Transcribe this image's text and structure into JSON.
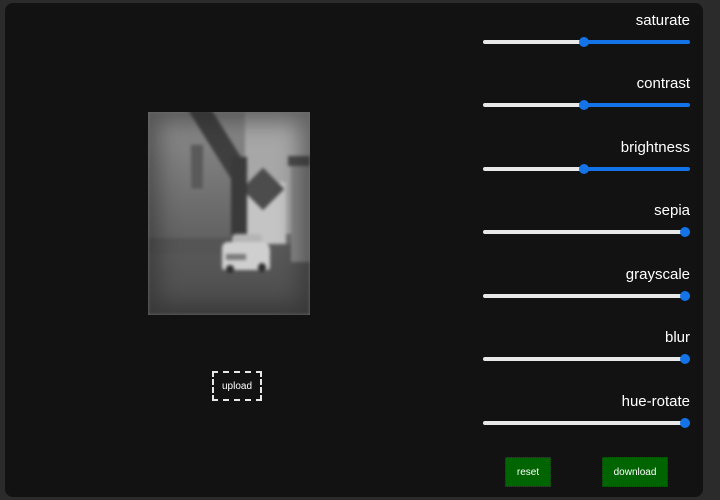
{
  "preview": {
    "description": "blurred grayscale photo of a village street with a white car"
  },
  "upload": {
    "label": "upload"
  },
  "filters": [
    {
      "label": "saturate",
      "value_percent": 50
    },
    {
      "label": "contrast",
      "value_percent": 50
    },
    {
      "label": "brightness",
      "value_percent": 50
    },
    {
      "label": "sepia",
      "value_percent": 100
    },
    {
      "label": "grayscale",
      "value_percent": 100
    },
    {
      "label": "blur",
      "value_percent": 100
    },
    {
      "label": "hue-rotate",
      "value_percent": 100
    }
  ],
  "buttons": {
    "reset": "reset",
    "download": "download"
  },
  "colors": {
    "accent": "#1473e6",
    "track": "#e8e8e8",
    "button_bg": "#006400",
    "panel_bg": "#121212",
    "page_bg": "#2b2b2b"
  }
}
